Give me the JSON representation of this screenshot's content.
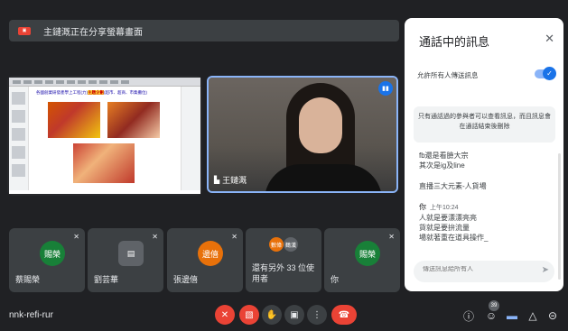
{
  "banner": {
    "text": "主鏈溉正在分享螢幕畫面",
    "icon": "present-screen-icon"
  },
  "stage": {
    "share_tile": {
      "name": ""
    },
    "camera_tile": {
      "name": "王鏈溉"
    },
    "shared_doc_title_a": "各國創業研發產學上工程(力)",
    "shared_doc_title_b": "主題企劃",
    "shared_doc_title_c": "(超市、超商、市集攤位)"
  },
  "participants": [
    {
      "avatar": "賜榮",
      "name": "蔡賜榮",
      "color": "#188038"
    },
    {
      "avatar": "",
      "name": "劉芸華",
      "color": "#5f6368"
    },
    {
      "avatar": "邊僖",
      "name": "張邊僖",
      "color": "#e8710a"
    },
    {
      "avatar": "",
      "name": "還有另外 33 位使用者",
      "mini": [
        "數偉",
        "鶴漢"
      ]
    },
    {
      "avatar": "賜榮",
      "name": "你",
      "color": "#188038"
    }
  ],
  "chat": {
    "title": "通話中的訊息",
    "allow_label": "允許所有人傳送訊息",
    "notice": "只有通話過的參與者可以查看訊息，而且訊息會在通話結束後刪除",
    "messages": [
      {
        "sender": "",
        "time": "",
        "lines": [
          "fb還是看臉大宗",
          "其次是ig及line"
        ]
      },
      {
        "sender": "",
        "time": "",
        "lines": [
          "直播三大元素-人貨場"
        ]
      },
      {
        "sender": "你",
        "time": "上午10:24",
        "lines": [
          "人就是要漂漂亮亮",
          "貨就是要拚流量",
          "場就著重在道具操作_"
        ]
      }
    ],
    "input_placeholder": "傳送訊息給所有人"
  },
  "bottom_bar": {
    "meeting_code": "nnk-refi-rur",
    "participant_count": "39"
  },
  "colors": {
    "accent": "#1a73e8",
    "danger": "#ea4335",
    "surface": "#3c4043",
    "background": "#202124"
  }
}
